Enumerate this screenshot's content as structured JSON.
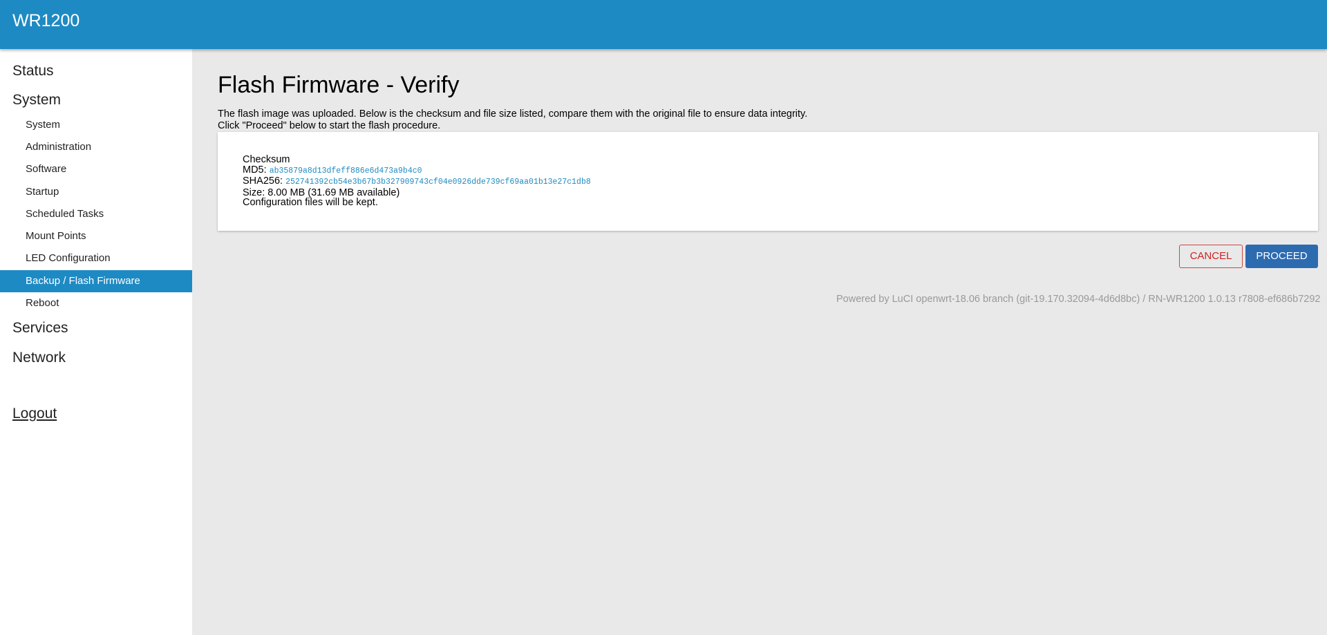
{
  "header": {
    "title": "WR1200"
  },
  "sidebar": {
    "status": "Status",
    "system": "System",
    "items": [
      {
        "label": "System"
      },
      {
        "label": "Administration"
      },
      {
        "label": "Software"
      },
      {
        "label": "Startup"
      },
      {
        "label": "Scheduled Tasks"
      },
      {
        "label": "Mount Points"
      },
      {
        "label": "LED Configuration"
      },
      {
        "label": "Backup / Flash Firmware",
        "active": true
      },
      {
        "label": "Reboot"
      }
    ],
    "services": "Services",
    "network": "Network",
    "logout": "Logout"
  },
  "main": {
    "title": "Flash Firmware - Verify",
    "desc1": "The flash image was uploaded. Below is the checksum and file size listed, compare them with the original file to ensure data integrity.",
    "desc2": "Click \"Proceed\" below to start the flash procedure.",
    "checksum_label": "Checksum",
    "md5_label": "MD5:",
    "md5": "ab35879a8d13dfeff886e6d473a9b4c0",
    "sha_label": "SHA256:",
    "sha256": "252741392cb54e3b67b3b327909743cf04e0926dde739cf69aa01b13e27c1db8",
    "size": "Size: 8.00 MB (31.69 MB available)",
    "config": "Configuration files will be kept.",
    "cancel": "CANCEL",
    "proceed": "PROCEED",
    "footer": "Powered by LuCI openwrt-18.06 branch (git-19.170.32094-4d6d8bc) / RN-WR1200 1.0.13 r7808-ef686b7292"
  },
  "colors": {
    "accent": "#1e8ac3",
    "proceed": "#2d6bb0",
    "cancel": "#cc2222"
  }
}
